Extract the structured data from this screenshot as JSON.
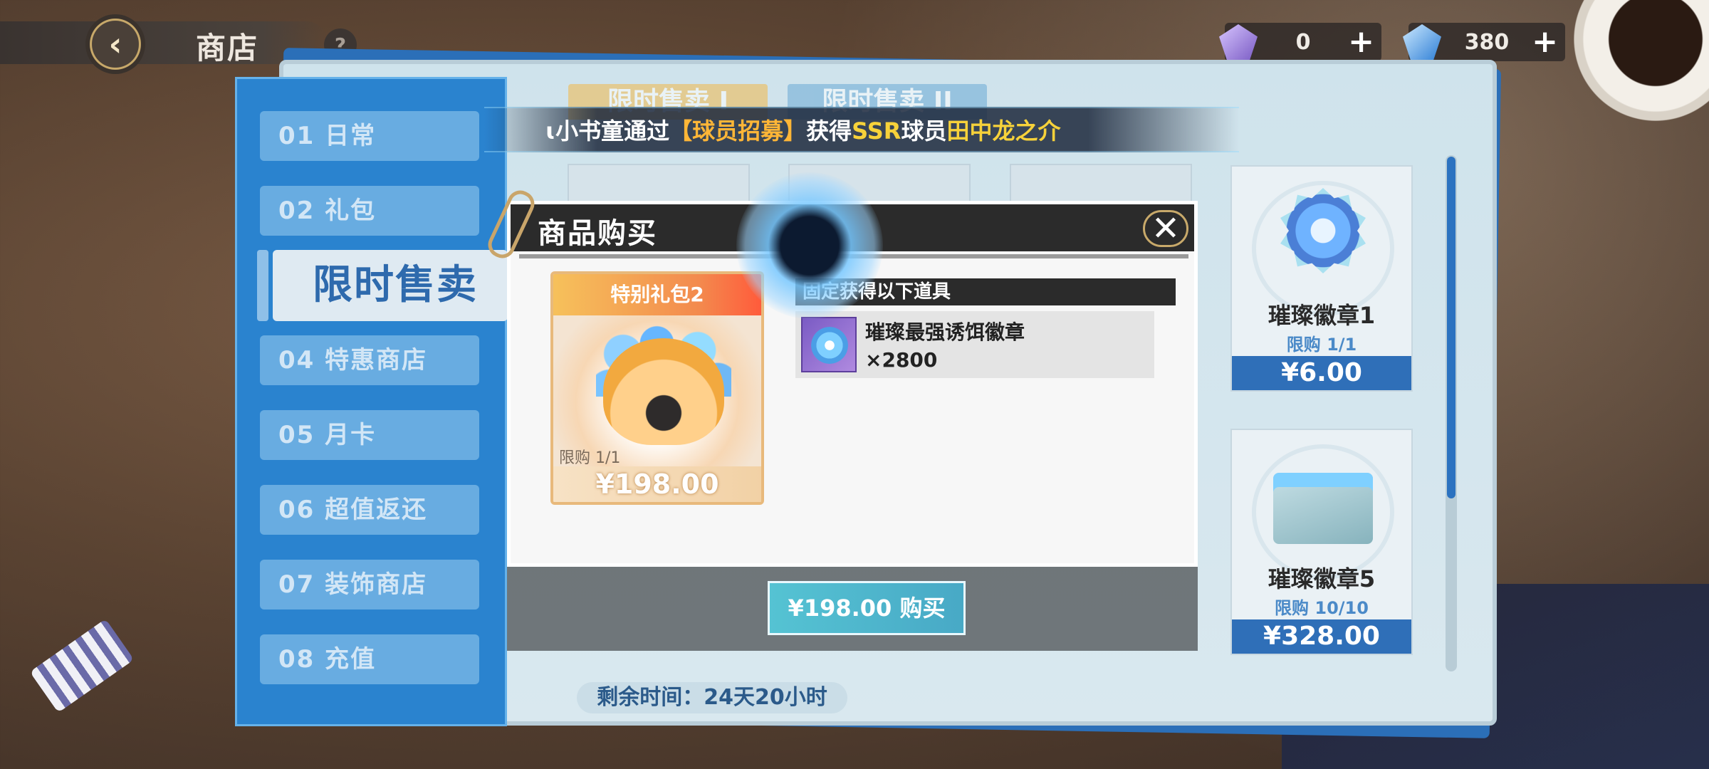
{
  "header": {
    "title": "商店"
  },
  "currencies": [
    {
      "icon": "purple-gem-icon",
      "value": "0",
      "color": "#9a79d6"
    },
    {
      "icon": "blue-gem-icon",
      "value": "380",
      "color": "#4ea8ff"
    }
  ],
  "sidebar": {
    "items": [
      {
        "label": "01  日常"
      },
      {
        "label": "02  礼包"
      },
      {
        "label": "限时售卖",
        "active": true
      },
      {
        "label": "04  特惠商店"
      },
      {
        "label": "05  月卡"
      },
      {
        "label": "06  超值返还"
      },
      {
        "label": "07  装饰商店"
      },
      {
        "label": "08  充值"
      }
    ]
  },
  "tabs": [
    {
      "label": "限时售卖 I"
    },
    {
      "label": "限时售卖 II"
    }
  ],
  "marquee": {
    "prefix": "ɩ小书童通过",
    "highlight1": "【球员招募】",
    "middle": "获得",
    "rarity": "SSR",
    "middle2": "球员",
    "player": "田中龙之介"
  },
  "cards": [
    {
      "name": "璀璨徽章1",
      "limit": "限购 1/1",
      "price": "¥6.00"
    },
    {
      "name": "璀璨徽章5",
      "limit": "限购 10/10",
      "price": "¥328.00"
    }
  ],
  "remaining": "剩余时间：24天20小时",
  "dialog": {
    "title": "商品购买",
    "gift": {
      "title": "特别礼包2",
      "limit": "限购 1/1",
      "price": "¥198.00"
    },
    "fixed_header": "固定获得以下道具",
    "item": {
      "name": "璀璨最强诱饵徽章",
      "qty": "×2800"
    },
    "buy_label": "¥198.00 购买"
  }
}
